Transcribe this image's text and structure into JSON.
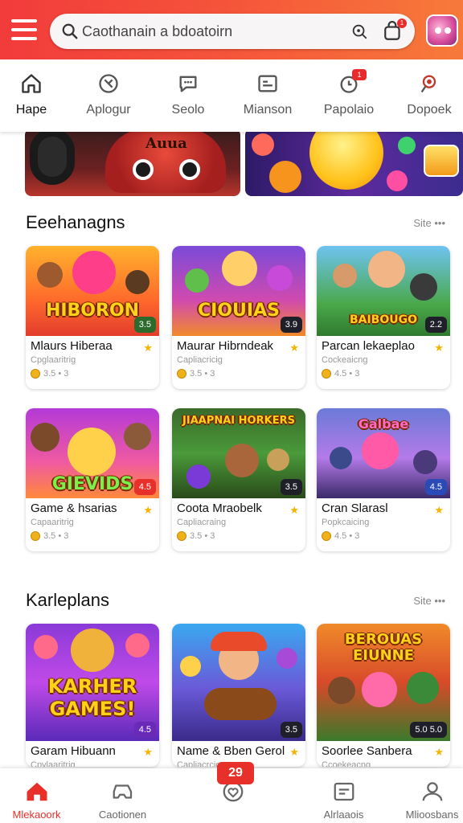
{
  "header": {
    "search_placeholder": "Caothanain a bdoatoirn",
    "cart_count": "1",
    "colors": {
      "gradient_start": "#f23b3b",
      "gradient_end": "#f77a3a"
    }
  },
  "categories": [
    {
      "label": "Hape",
      "icon": "home-icon",
      "active": true
    },
    {
      "label": "Aplogur",
      "icon": "palette-icon"
    },
    {
      "label": "Seolo",
      "icon": "chat-icon"
    },
    {
      "label": "Mianson",
      "icon": "list-window-icon"
    },
    {
      "label": "Papolaio",
      "icon": "clock-icon",
      "badge": "1"
    },
    {
      "label": "Dopoek",
      "icon": "pin-icon"
    }
  ],
  "banner": {
    "left_title": "Auua"
  },
  "sections": [
    {
      "title": "Eeehanagns",
      "more": "Site •••",
      "games": [
        {
          "image_title": "HIBORON",
          "pill": "3.5",
          "name": "Mlaurs Hiberaa",
          "sub": "Cpglaaritrig",
          "meta": "3.5 • 3"
        },
        {
          "image_title": "CIOUIAS",
          "pill": "3.9",
          "name": "Maurar Hibrndeak",
          "sub": "Capliacricig",
          "meta": "3.5 • 3"
        },
        {
          "image_title": "BAIBOUGO",
          "pill": "2.2",
          "name": "Parcan lekaeplao",
          "sub": "Cockeaicng",
          "meta": "4.5 • 3"
        },
        {
          "image_title": "GIEVIDS",
          "pill": "4.5",
          "name": "Game & hsarias",
          "sub": "Capaaritrig",
          "meta": "3.5 • 3"
        },
        {
          "image_title": "JIAAPNAI HORKERS",
          "pill": "3.5",
          "name": "Coota Mraobelk",
          "sub": "Capliacraing",
          "meta": "3.5 • 3"
        },
        {
          "image_title": "Galbae",
          "pill": "4.5",
          "name": "Cran Slarasl",
          "sub": "Popkcaicing",
          "meta": "4.5 • 3"
        }
      ]
    },
    {
      "title": "Karleplans",
      "more": "Site •••",
      "games": [
        {
          "image_title": "KARHER GAMES!",
          "pill": "4.5",
          "name": "Garam Hibuann",
          "sub": "Cpylaaritrig",
          "meta": ""
        },
        {
          "image_title": "",
          "pill": "3.5",
          "name": "Name & Bben Gerol",
          "sub": "Capliacrcig",
          "meta": ""
        },
        {
          "image_title": "BEROUAS EIUNNE",
          "pill": "5.0 5.0",
          "name": "Soorlee Sanbera",
          "sub": "Ccoekeacng",
          "meta": ""
        }
      ]
    }
  ],
  "bottom_nav": [
    {
      "label": "Mlekaoork",
      "icon": "home-icon",
      "active": true
    },
    {
      "label": "Caotionen",
      "icon": "gamepad-icon"
    },
    {
      "label": "",
      "icon": "heart-shield-icon"
    },
    {
      "label": "Alrlaaois",
      "icon": "message-icon"
    },
    {
      "label": "Mlioosbans",
      "icon": "user-icon"
    }
  ],
  "bottom_badge": "29"
}
